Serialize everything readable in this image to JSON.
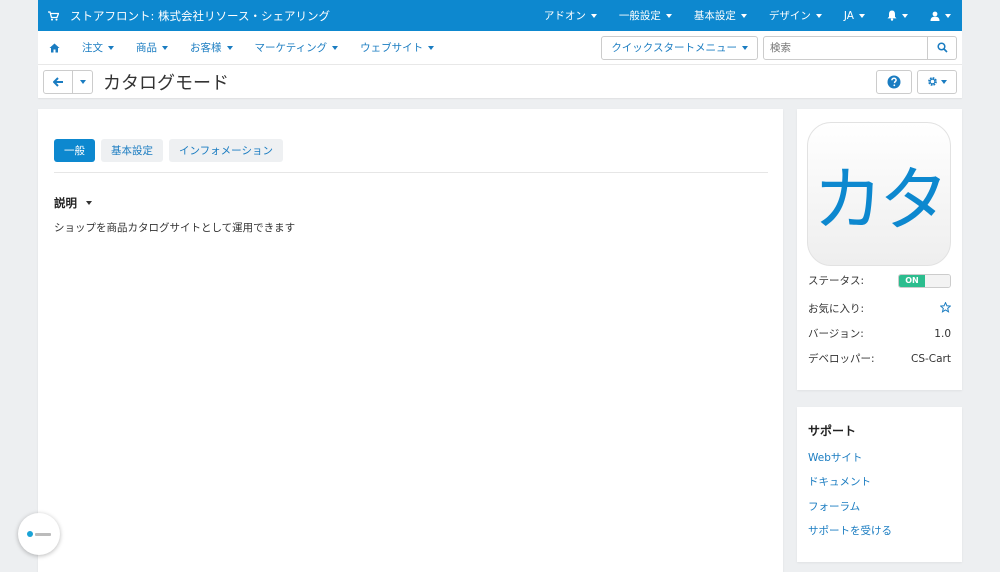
{
  "colors": {
    "brand": "#0d88cf",
    "link": "#1a7cc1",
    "status_on": "#2bbd8e"
  },
  "topbar": {
    "store_label": "ストアフロント: 株式会社リソース・シェアリング",
    "items": [
      "アドオン",
      "一般設定",
      "基本設定",
      "デザイン",
      "JA"
    ],
    "icons": [
      "cart-icon",
      "bell-icon",
      "user-icon"
    ]
  },
  "subnav": {
    "items": [
      "注文",
      "商品",
      "お客様",
      "マーケティング",
      "ウェブサイト"
    ],
    "quickstart_label": "クイックスタートメニュー",
    "search_placeholder": "検索"
  },
  "titlebar": {
    "title": "カタログモード"
  },
  "tabs": [
    "一般",
    "基本設定",
    "インフォメーション"
  ],
  "main": {
    "section_title": "説明",
    "description": "ショップを商品カタログサイトとして運用できます"
  },
  "info": {
    "icon_text": "カタ",
    "status_label": "ステータス:",
    "status_value": "ON",
    "favorite_label": "お気に入り:",
    "version_label": "バージョン:",
    "version_value": "1.0",
    "developer_label": "デベロッパー:",
    "developer_value": "CS-Cart"
  },
  "support": {
    "title": "サポート",
    "links": [
      "Webサイト",
      "ドキュメント",
      "フォーラム",
      "サポートを受ける"
    ]
  }
}
